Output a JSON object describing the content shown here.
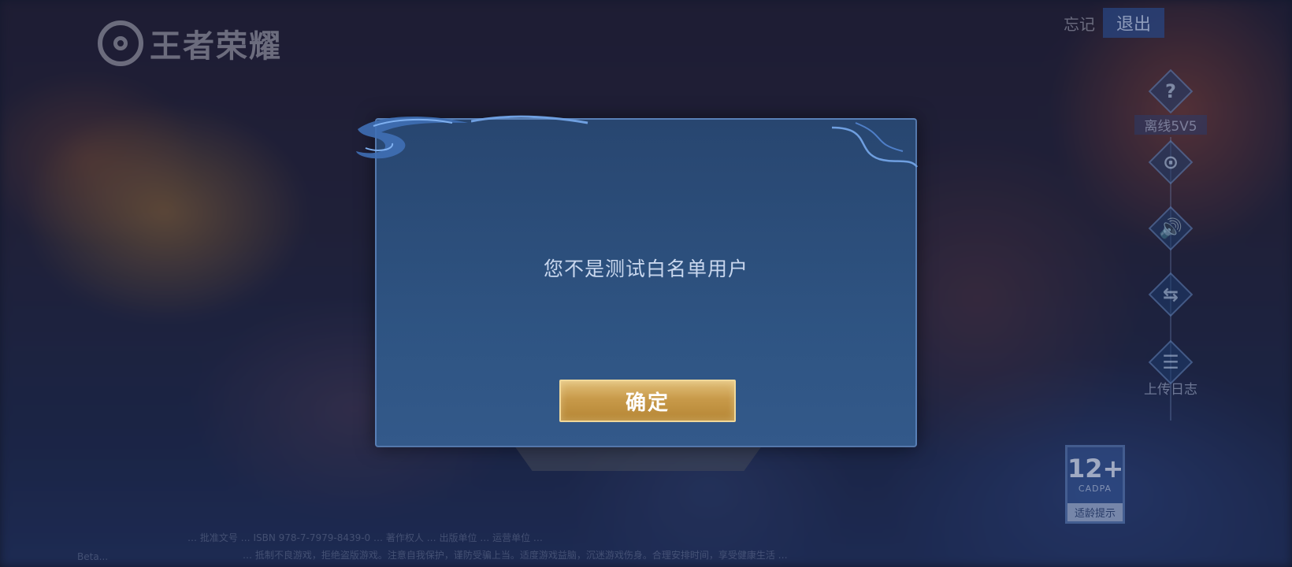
{
  "logo": {
    "text": "王者荣耀"
  },
  "topbar": {
    "forget_label": "忘记",
    "exit_label": "退出"
  },
  "sidebar": {
    "items": [
      {
        "glyph": "?",
        "label": "离线5V5",
        "icon": "help-icon"
      },
      {
        "glyph": "⊙",
        "label": "",
        "icon": "camera-icon"
      },
      {
        "glyph": "🔊",
        "label": "",
        "icon": "sound-icon"
      },
      {
        "glyph": "⇆",
        "label": "",
        "icon": "switch-icon"
      },
      {
        "glyph": "☰",
        "label": "上传日志",
        "icon": "log-icon"
      }
    ]
  },
  "age_badge": {
    "age": "12+",
    "org": "CADPA",
    "tip": "适龄提示"
  },
  "footer": {
    "version": "Beta...",
    "line1": "… 批准文号 … ISBN 978-7-7979-8439-0 … 著作权人 … 出版单位 … 运营单位 …",
    "line2": "… 抵制不良游戏，拒绝盗版游戏。注意自我保护，谨防受骗上当。适度游戏益脑，沉迷游戏伤身。合理安排时间，享受健康生活 …"
  },
  "dialog": {
    "message": "您不是测试白名单用户",
    "confirm_label": "确定"
  },
  "colors": {
    "dialog_bg": "#2f5584",
    "button_gold": "#c89a4a",
    "message_text": "#c9d7ee"
  }
}
